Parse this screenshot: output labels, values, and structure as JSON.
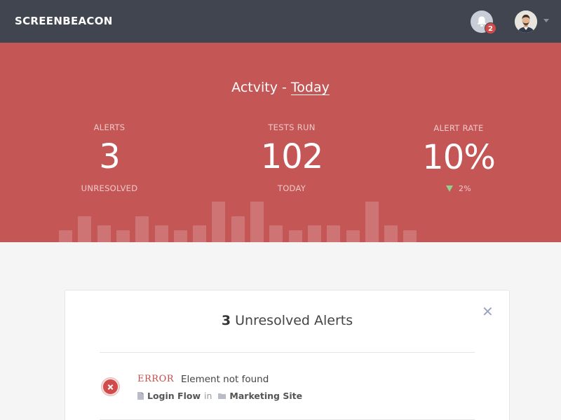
{
  "header": {
    "brand": "SCREENBEACON",
    "notification_count": "2"
  },
  "hero": {
    "title_prefix": "Actvity - ",
    "title_range": "Today",
    "stats": [
      {
        "label": "ALERTS",
        "value": "3",
        "sub": "UNRESOLVED"
      },
      {
        "label": "TESTS RUN",
        "value": "102",
        "sub": "TODAY"
      },
      {
        "label": "ALERT RATE",
        "value": "10%",
        "trend": "2%",
        "trend_direction": "down"
      }
    ],
    "activity_bars": [
      0.25,
      0.55,
      0.35,
      0.25,
      0.55,
      0.35,
      0.25,
      0.35,
      0.85,
      0.55,
      0.85,
      0.35,
      0.25,
      0.35,
      0.35,
      0.25,
      0.85,
      0.35,
      0.25
    ],
    "colors": {
      "background": "#c55656",
      "trend_down": "#8fd28f"
    }
  },
  "alerts_card": {
    "count": "3",
    "title_suffix": " Unresolved Alerts",
    "alerts": [
      {
        "type": "ERROR",
        "message": "Element not found",
        "test": "Login Flow",
        "in_text": "in",
        "project": "Marketing Site"
      }
    ]
  }
}
